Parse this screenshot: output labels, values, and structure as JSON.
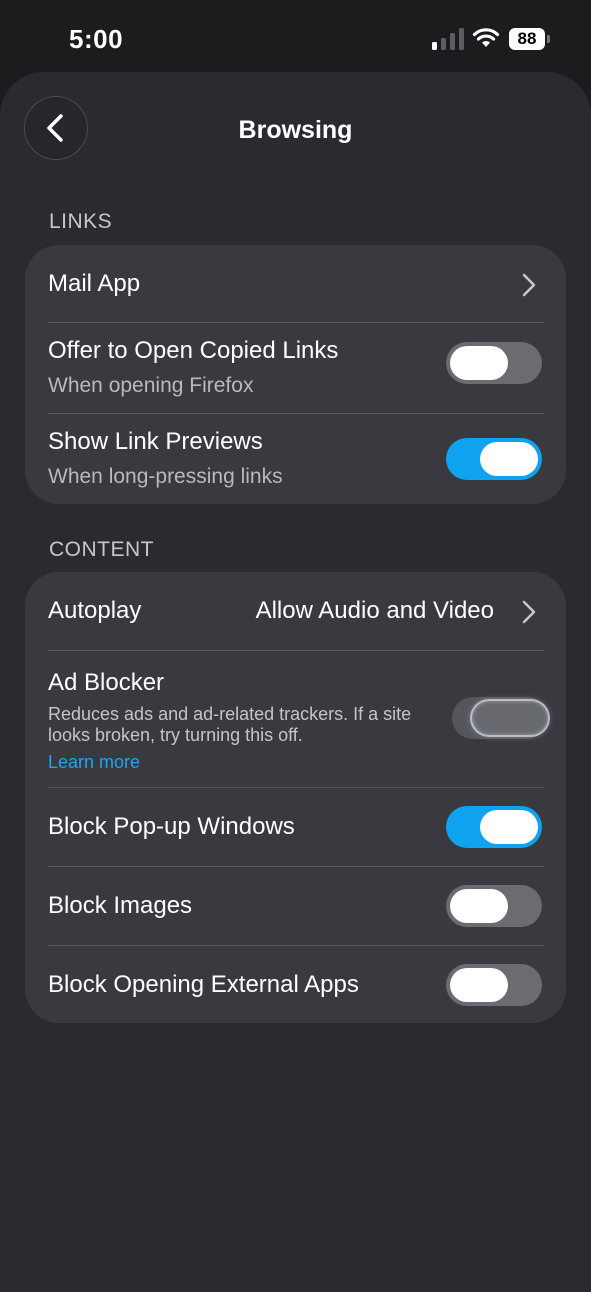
{
  "status_bar": {
    "time": "5:00",
    "battery": "88"
  },
  "header": {
    "title": "Browsing"
  },
  "links_section": {
    "header": "LINKS",
    "mail_app": {
      "label": "Mail App"
    },
    "open_copied": {
      "label": "Offer to Open Copied Links",
      "subtitle": "When opening Firefox",
      "on": false
    },
    "link_previews": {
      "label": "Show Link Previews",
      "subtitle": "When long-pressing links",
      "on": true
    }
  },
  "content_section": {
    "header": "CONTENT",
    "autoplay": {
      "label": "Autoplay",
      "value": "Allow Audio and Video"
    },
    "ad_blocker": {
      "label": "Ad Blocker",
      "description": "Reduces ads and ad-related trackers. If a site looks broken, try turning this off.",
      "link": "Learn more",
      "on": false
    },
    "block_popups": {
      "label": "Block Pop-up Windows",
      "on": true
    },
    "block_images": {
      "label": "Block Images",
      "on": false
    },
    "block_external_apps": {
      "label": "Block Opening External Apps",
      "on": false
    }
  },
  "colors": {
    "accent": "#0fa3ef",
    "link": "#1da7e8",
    "card": "#39393f",
    "sheet": "#2a2a31"
  }
}
